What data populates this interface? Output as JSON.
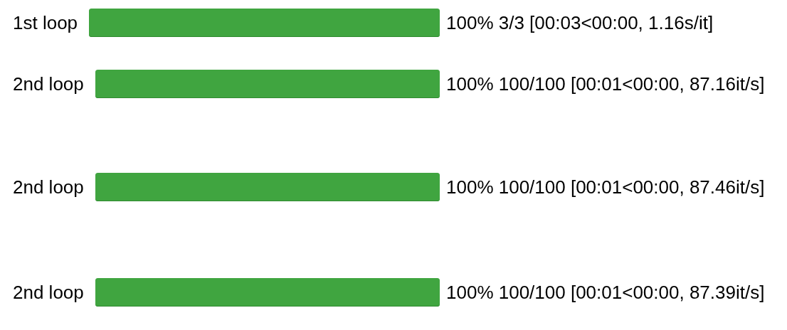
{
  "progress_bars": [
    {
      "label": "1st loop",
      "level": 1,
      "status": "100% 3/3 [00:03<00:00, 1.16s/it]"
    },
    {
      "label": "2nd loop",
      "level": 1,
      "status": "100% 100/100 [00:01<00:00, 87.16it/s]"
    },
    {
      "label": "2nd loop",
      "level": 1,
      "status": "100% 100/100 [00:01<00:00, 87.46it/s]"
    },
    {
      "label": "2nd loop",
      "level": 1,
      "status": "100% 100/100 [00:01<00:00, 87.39it/s]"
    }
  ]
}
